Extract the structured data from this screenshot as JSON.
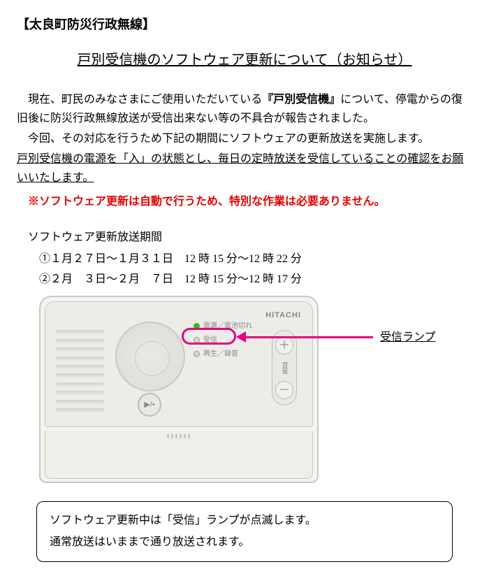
{
  "header_tag": "【太良町防災行政無線】",
  "title": "戸別受信機のソフトウェア更新について（お知らせ）",
  "para1_pre": "現在、町民のみなさまにご使用いただいている",
  "para1_bold": "『戸別受信機』",
  "para1_post": "について、停電からの復旧後に防災行政無線放送が受信出来ない等の不具合が報告されました。",
  "para2": "今回、その対応を行うため下記の期間にソフトウェアの更新放送を実施します。",
  "para3": "戸別受信機の電源を「入」の状態とし、毎日の定時放送を受信していることの確認をお願いいたします。",
  "red_note": "※ソフトウェア更新は自動で行うため、特別な作業は必要ありません。",
  "schedule_head": "ソフトウェア更新放送期間",
  "schedule1": "①１月２７日～１月３１日　12 時 15 分～12 時 22 分",
  "schedule2": "②２月　３日～２月　７日　12 時 15 分～12 時 17 分",
  "device": {
    "brand": "HITACHI",
    "led1": "電源／電池切れ",
    "led2": "受信",
    "led3": "再生／録音",
    "vol_label": "音量",
    "play": "▶/•"
  },
  "callout_label": "受信ランプ",
  "box_line1": "ソフトウェア更新中は「受信」ランプが点滅します。",
  "box_line2": "通常放送はいままで通り放送されます。"
}
